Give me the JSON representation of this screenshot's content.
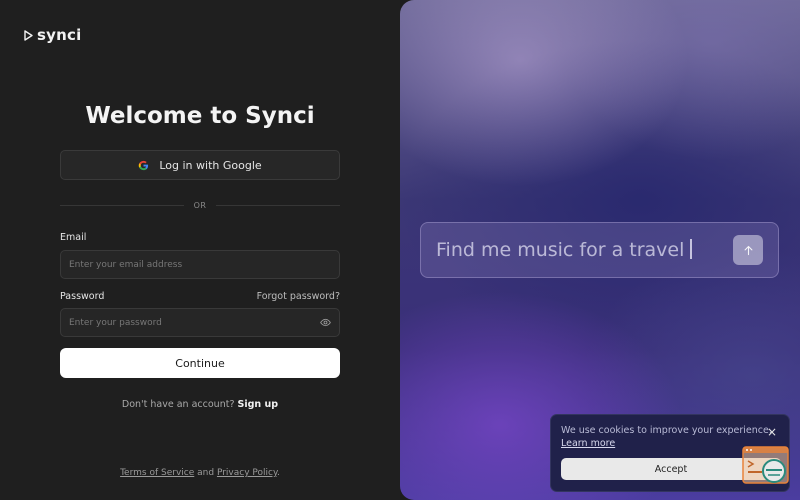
{
  "brand": {
    "logo_text": "synci"
  },
  "login": {
    "title": "Welcome to Synci",
    "google_button": "Log in with Google",
    "divider": "OR",
    "email_label": "Email",
    "email_placeholder": "Enter your email address",
    "password_label": "Password",
    "forgot_password": "Forgot password?",
    "password_placeholder": "Enter your password",
    "continue_button": "Continue",
    "no_account_text": "Don't have an account?",
    "signup_link": "Sign up",
    "footer_tos": "Terms of Service",
    "footer_and": "and",
    "footer_privacy": "Privacy Policy",
    "footer_end": "."
  },
  "hero": {
    "prompt_text": "Find me music for a travel"
  },
  "cookie_banner": {
    "message": "We use cookies to improve your experience.",
    "learn_more": "Learn more",
    "close": "×",
    "accept_button": "Accept"
  },
  "colors": {
    "left_bg": "#1f1f1f",
    "accent_button": "#ffffff",
    "cookie_bg": "#20214a",
    "helper_orange": "#e8833a",
    "helper_teal": "#2a8a7d"
  },
  "icons": {
    "logo": "play-triangle-icon",
    "google": "google-icon",
    "password_toggle": "eye-icon",
    "send": "arrow-up-icon",
    "helper": "assistant-widget-icon"
  }
}
